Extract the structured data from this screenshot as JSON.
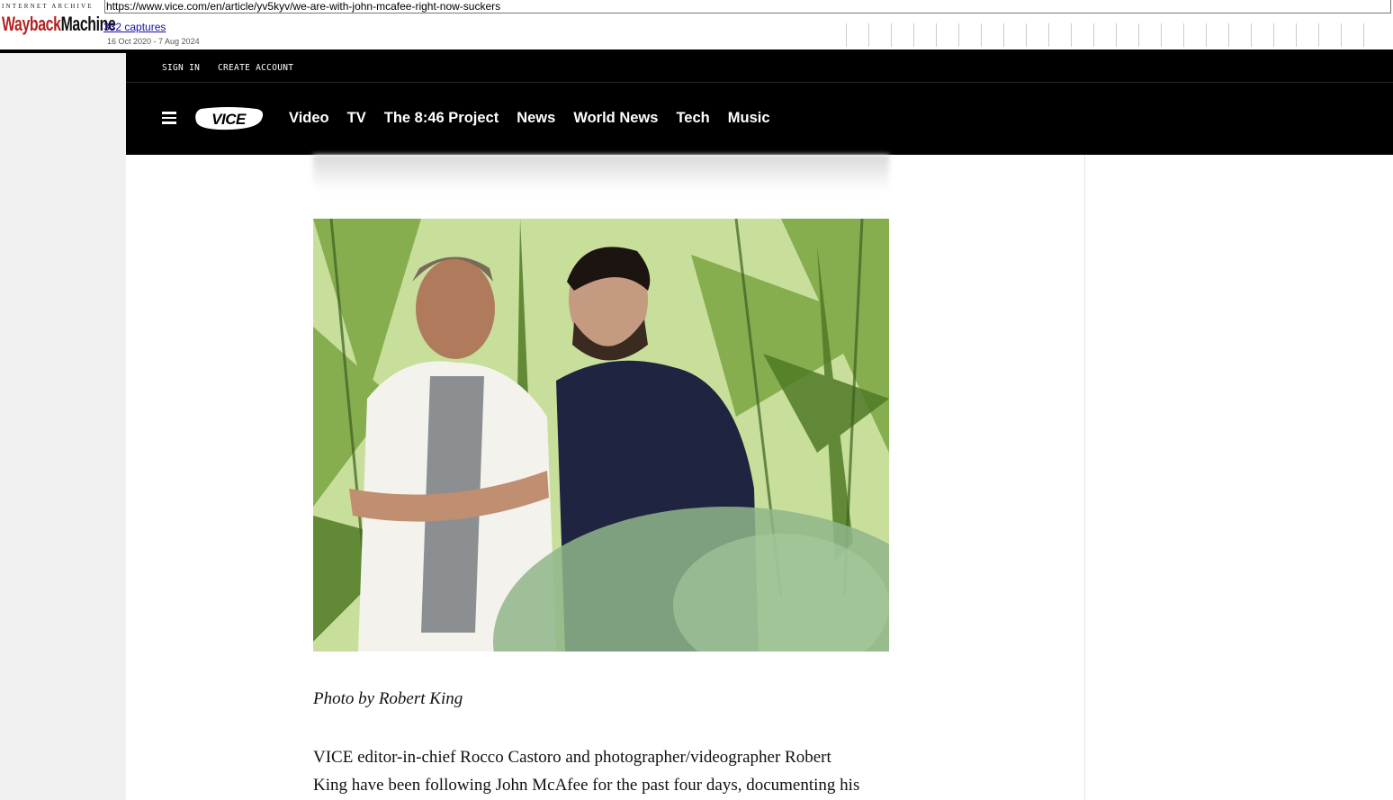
{
  "wayback": {
    "archive_label": "INTERNET ARCHIVE",
    "logo_word1": "Wayback",
    "logo_word2": "Machine",
    "url": "https://www.vice.com/en/article/yv5kyv/we-are-with-john-mcafee-right-now-suckers",
    "captures": "332 captures",
    "date_range": "16 Oct 2020 - 7 Aug 2024"
  },
  "topbar": {
    "sign_in": "SIGN IN",
    "create_account": "CREATE ACCOUNT"
  },
  "nav": {
    "logo": "VICE",
    "links": [
      "Video",
      "TV",
      "The 8:46 Project",
      "News",
      "World News",
      "Tech",
      "Music"
    ]
  },
  "article": {
    "caption": "Photo by Robert King",
    "paragraph_lines": [
      "VICE editor-in-chief Rocco Castoro and photographer/videographer Robert",
      "King have been following John McAfee for the past four days, documenting his"
    ]
  },
  "colors": {
    "nav_bg": "#000000",
    "wayback_red": "#b22222",
    "link_blue": "#1a0dab"
  }
}
